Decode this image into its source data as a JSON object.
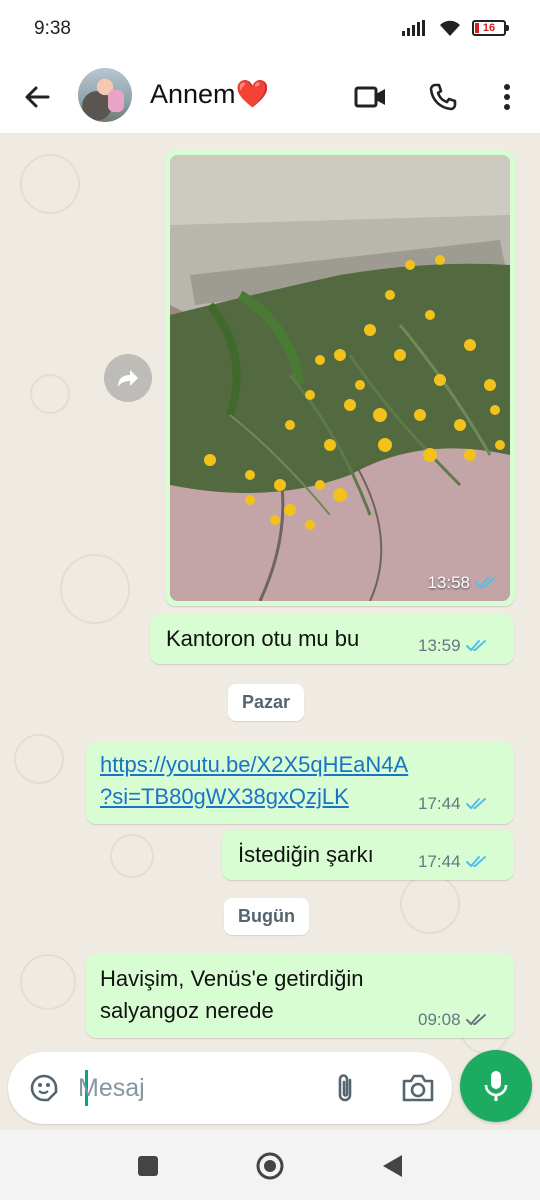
{
  "status_bar": {
    "time": "9:38",
    "battery": "16"
  },
  "header": {
    "contact_name": "Annem❤️"
  },
  "messages": [
    {
      "type": "image",
      "time": "13:58",
      "status": "read"
    },
    {
      "type": "text",
      "text": "Kantoron otu mu bu",
      "time": "13:59",
      "status": "read"
    },
    {
      "type": "date",
      "text": "Pazar"
    },
    {
      "type": "link",
      "line1": "https://youtu.be/X2X5qHEaN4A",
      "line2": "?si=TB80gWX38gxQzjLK",
      "time": "17:44",
      "status": "read"
    },
    {
      "type": "text",
      "text": "İstediğin şarkı",
      "time": "17:44",
      "status": "read"
    },
    {
      "type": "date",
      "text": "Bugün"
    },
    {
      "type": "text",
      "line1": "Havişim, Venüs'e getirdiğin",
      "line2": "salyangoz nerede",
      "time": "09:08",
      "status": "delivered"
    }
  ],
  "composer": {
    "placeholder": "Mesaj"
  },
  "colors": {
    "bubble_out": "#d9fdd3",
    "read_tick": "#53bdeb",
    "accent": "#1daa61",
    "link": "#1a73c9"
  }
}
